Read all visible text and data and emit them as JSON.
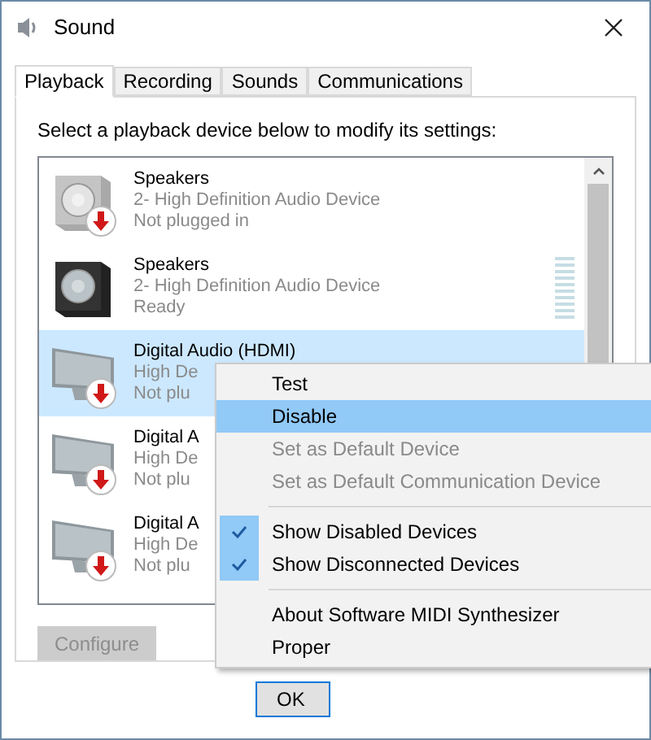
{
  "window": {
    "title": "Sound"
  },
  "tabs": [
    {
      "label": "Playback",
      "selected": true
    },
    {
      "label": "Recording",
      "selected": false
    },
    {
      "label": "Sounds",
      "selected": false
    },
    {
      "label": "Communications",
      "selected": false
    }
  ],
  "instruction": "Select a playback device below to modify its settings:",
  "devices": [
    {
      "kind": "speaker",
      "name": "Speakers",
      "description": "2- High Definition Audio Device",
      "status": "Not plugged in",
      "plugged_in": false,
      "selected": false,
      "meter": false
    },
    {
      "kind": "speaker-dark",
      "name": "Speakers",
      "description": "2- High Definition Audio Device",
      "status": "Ready",
      "plugged_in": true,
      "selected": false,
      "meter": true
    },
    {
      "kind": "monitor",
      "name": "Digital Audio (HDMI)",
      "description": "High De",
      "status": "Not plu",
      "plugged_in": false,
      "selected": true,
      "meter": false
    },
    {
      "kind": "monitor",
      "name": "Digital A",
      "description": "High De",
      "status": "Not plu",
      "plugged_in": false,
      "selected": false,
      "meter": false
    },
    {
      "kind": "monitor",
      "name": "Digital A",
      "description": "High De",
      "status": "Not plu",
      "plugged_in": false,
      "selected": false,
      "meter": false
    }
  ],
  "configure_button": {
    "label": "Configure",
    "disabled": true
  },
  "ok_button": {
    "label": "OK"
  },
  "context_menu": [
    {
      "kind": "item",
      "label": "Test",
      "disabled": false,
      "checked": false,
      "selected": false
    },
    {
      "kind": "item",
      "label": "Disable",
      "disabled": false,
      "checked": false,
      "selected": true
    },
    {
      "kind": "item",
      "label": "Set as Default Device",
      "disabled": true,
      "checked": false,
      "selected": false
    },
    {
      "kind": "item",
      "label": "Set as Default Communication Device",
      "disabled": true,
      "checked": false,
      "selected": false
    },
    {
      "kind": "separator"
    },
    {
      "kind": "item",
      "label": "Show Disabled Devices",
      "disabled": false,
      "checked": true,
      "selected": false
    },
    {
      "kind": "item",
      "label": "Show Disconnected Devices",
      "disabled": false,
      "checked": true,
      "selected": false
    },
    {
      "kind": "separator"
    },
    {
      "kind": "item",
      "label": "About Software MIDI Synthesizer",
      "disabled": false,
      "checked": false,
      "selected": false
    },
    {
      "kind": "item",
      "label": "Proper",
      "disabled": false,
      "checked": false,
      "selected": false
    }
  ]
}
